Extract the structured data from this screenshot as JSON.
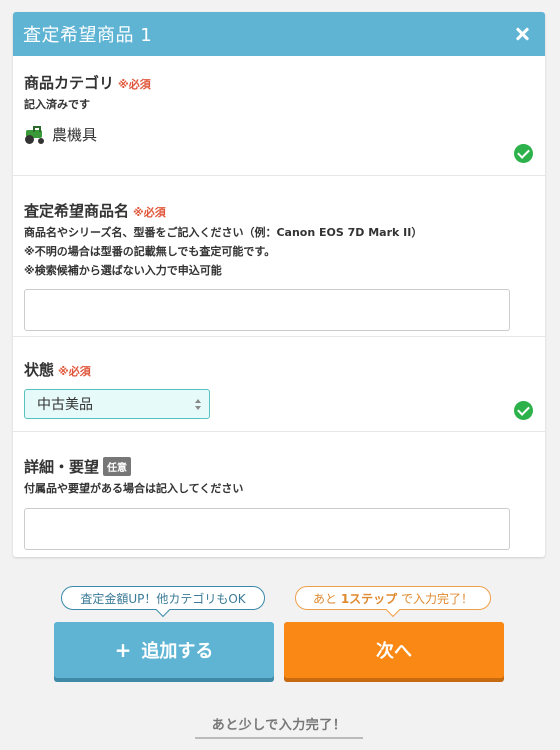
{
  "card": {
    "title": "査定希望商品 1"
  },
  "category": {
    "label": "商品カテゴリ",
    "required": "※必須",
    "status": "記入済みです",
    "value": "農機具",
    "icon": "tractor-icon"
  },
  "product_name": {
    "label": "査定希望商品名",
    "required": "※必須",
    "help": [
      "商品名やシリーズ名、型番をご記入ください（例：Canon EOS 7D Mark II）",
      "※不明の場合は型番の記載無しでも査定可能です。",
      "※検索候補から選ばない入力で申込可能"
    ],
    "value": "",
    "placeholder": ""
  },
  "condition": {
    "label": "状態",
    "required": "※必須",
    "selected": "中古美品"
  },
  "details": {
    "label": "詳細・要望",
    "optional": "任意",
    "help": "付属品や要望がある場合は記入してください",
    "value": "",
    "placeholder": ""
  },
  "bubbles": {
    "left": "査定金額UP！他カテゴリもOK",
    "right_prefix": "あと ",
    "right_bold": "1ステップ",
    "right_suffix": " で入力完了！"
  },
  "buttons": {
    "add_plus": "+",
    "add_label": "追加する",
    "next_label": "次へ"
  },
  "footer": {
    "note": "あと少しで入力完了！"
  },
  "colors": {
    "header": "#5fb4d4",
    "required": "#e0563a",
    "check": "#2db14a",
    "next": "#f98815"
  }
}
